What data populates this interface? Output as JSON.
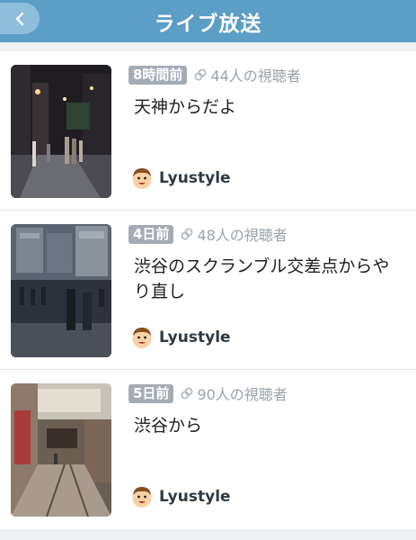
{
  "header": {
    "title": "ライブ放送",
    "back_icon": "chevron-left-icon"
  },
  "colors": {
    "header_bg": "#5b9ec6",
    "badge_bg": "#a3acb6",
    "muted_text": "#9ba3ab"
  },
  "broadcasts": [
    {
      "time_ago": "8時間前",
      "viewers": "44人の視聴者",
      "title": "天神からだよ",
      "user": "Lyustyle"
    },
    {
      "time_ago": "4日前",
      "viewers": "48人の視聴者",
      "title": "渋谷のスクランブル交差点からやり直し",
      "user": "Lyustyle"
    },
    {
      "time_ago": "5日前",
      "viewers": "90人の視聴者",
      "title": "渋谷から",
      "user": "Lyustyle"
    }
  ]
}
